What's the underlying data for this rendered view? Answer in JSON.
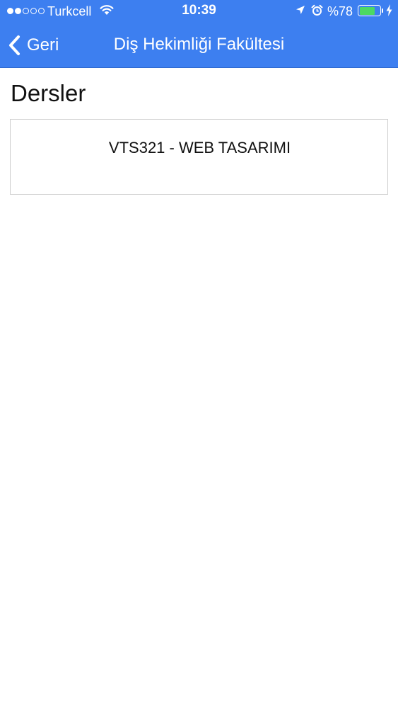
{
  "status_bar": {
    "carrier": "Turkcell",
    "time": "10:39",
    "battery_percent": "%78",
    "battery_level": 0.78,
    "signal_bars_filled": 2,
    "signal_bars_total": 5,
    "icons": [
      "wifi-icon",
      "location-arrow-icon",
      "alarm-clock-icon",
      "battery-icon",
      "charging-bolt-icon"
    ]
  },
  "nav": {
    "back_label": "Geri",
    "title": "Diş Hekimliği Fakültesi"
  },
  "main": {
    "title": "Dersler",
    "courses": [
      {
        "label": "VTS321 - WEB TASARIMI"
      }
    ]
  },
  "colors": {
    "accent": "#3d7ff0",
    "battery": "#4cd964"
  }
}
